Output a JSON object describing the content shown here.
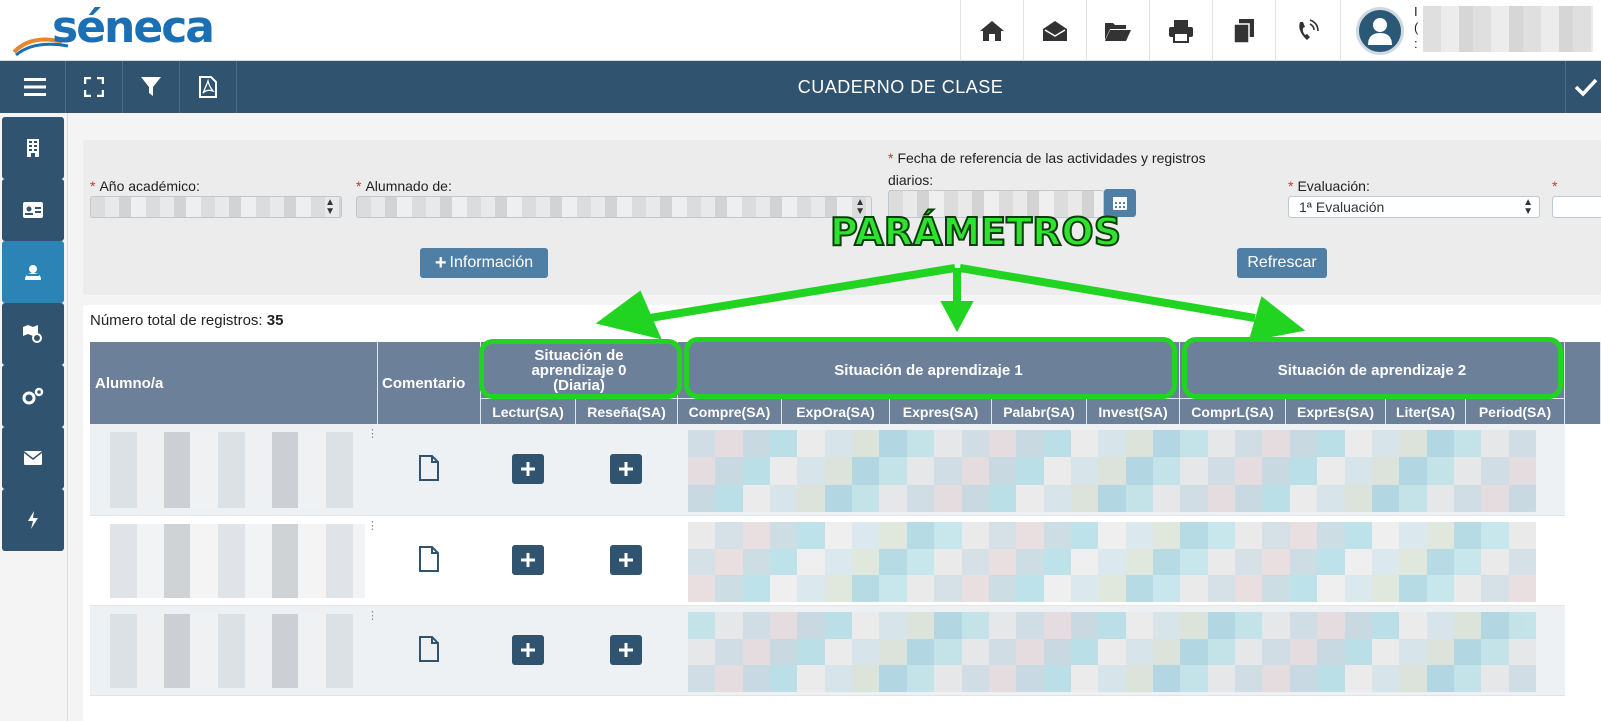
{
  "app": {
    "logo_text": "séneca",
    "page_title": "CUADERNO DE CLASE"
  },
  "topbar": {
    "icons": [
      "home-icon",
      "envelope-open-icon",
      "folder-open-icon",
      "print-icon",
      "copy-icon",
      "phone-icon"
    ],
    "user": {
      "name_initial": "I",
      "line2": "(",
      "line3": ":"
    }
  },
  "navbar": {
    "icons": [
      "menu-icon",
      "expand-icon",
      "filter-icon",
      "pdf-icon",
      "check-icon"
    ]
  },
  "sidebar": {
    "items": [
      {
        "icon": "building-icon",
        "active": false
      },
      {
        "icon": "id-card-icon",
        "active": false
      },
      {
        "icon": "users-icon",
        "active": true
      },
      {
        "icon": "map-settings-icon",
        "active": false
      },
      {
        "icon": "gears-icon",
        "active": false
      },
      {
        "icon": "mail-icon",
        "active": false
      },
      {
        "icon": "bolt-icon",
        "active": false
      }
    ]
  },
  "filters": {
    "year_label": "Año académico:",
    "students_label": "Alumnado de:",
    "date_label_line1": "Fecha de referencia de las actividades y registros",
    "date_label_line2": "diarios:",
    "evaluation_label": "Evaluación:",
    "evaluation_value": "1ª Evaluación",
    "info_button": "Información",
    "refresh_button": "Refrescar"
  },
  "annotation": {
    "text": "PARÁMETROS",
    "color": "#2de32d"
  },
  "table": {
    "total_label": "Número total de registros:",
    "total_value": "35",
    "col_student": "Alumno/a",
    "col_comment": "Comentario",
    "groups": [
      {
        "line1": "Situación de",
        "line2": "aprendizaje 0",
        "line3": "(Diaria)"
      },
      {
        "title": "Situación de aprendizaje 1"
      },
      {
        "title": "Situación de aprendizaje 2"
      }
    ],
    "sub_headers": [
      "Lectur(SA)",
      "Reseña(SA)",
      "Compre(SA)",
      "ExpOra(SA)",
      "Expres(SA)",
      "Palabr(SA)",
      "Invest(SA)",
      "ComprL(SA)",
      "ExprEs(SA)",
      "Liter(SA)",
      "Period(SA)"
    ]
  },
  "colors": {
    "header_bg": "#30536f",
    "table_header": "#6c8099",
    "accent_green": "#22d422",
    "button_blue": "#4f7fa5"
  }
}
